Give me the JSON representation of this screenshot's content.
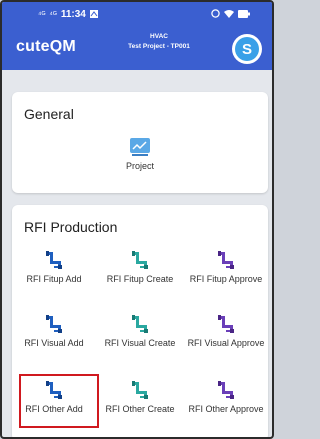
{
  "status": {
    "sig1": "⁴ᴳ",
    "sig2": "⁴ᴳ",
    "time": "11:34",
    "right_icons": "⏰ ▾ ▮"
  },
  "header": {
    "brand": "cuteQM",
    "project_line1": "HVAC",
    "project_line2": "Test Project - TP001",
    "avatar_letter": "S"
  },
  "general": {
    "title": "General",
    "items": [
      {
        "label": "Project"
      }
    ]
  },
  "rfi": {
    "title": "RFI Production",
    "items": [
      {
        "label": "RFI Fitup Add",
        "icon_color": "#1f5fbf"
      },
      {
        "label": "RFI Fitup Create",
        "icon_color": "#2aa8a0"
      },
      {
        "label": "RFI Fitup Approve",
        "icon_color": "#6a3fb8"
      },
      {
        "label": "RFI Visual Add",
        "icon_color": "#1f5fbf"
      },
      {
        "label": "RFI Visual Create",
        "icon_color": "#2aa8a0"
      },
      {
        "label": "RFI Visual Approve",
        "icon_color": "#6a3fb8"
      },
      {
        "label": "RFI Other Add",
        "icon_color": "#1f5fbf"
      },
      {
        "label": "RFI Other Create",
        "icon_color": "#2aa8a0"
      },
      {
        "label": "RFI Other Approve",
        "icon_color": "#6a3fb8"
      }
    ]
  },
  "colors": {
    "header_bg": "#3b5fd0",
    "highlight": "#d0191f"
  }
}
